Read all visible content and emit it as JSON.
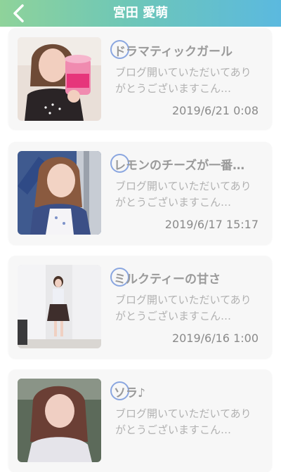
{
  "header": {
    "title": "宮田 愛萌"
  },
  "posts": [
    {
      "title": "ドラマティックガール",
      "excerpt": "ブログ開いていただいてありがとうございますこん…",
      "date": "2019/6/21 0:08"
    },
    {
      "title": "レモンのチーズが一番…",
      "excerpt": "ブログ開いていただいてありがとうございますこん…",
      "date": "2019/6/17 15:17"
    },
    {
      "title": "ミルクティーの甘さ",
      "excerpt": "ブログ開いていただいてありがとうございますこん…",
      "date": "2019/6/16 1:00"
    },
    {
      "title": "ソラ♪",
      "excerpt": "ブログ開いていただいてありがとうございますこん…",
      "date": ""
    }
  ],
  "colors": {
    "header_gradient": [
      "#8fd39a",
      "#5bb9df"
    ],
    "card_bg": "#f7f7f7",
    "dot_ring": "#8aa6e0"
  },
  "icons": {
    "back": "chevron-left-icon",
    "unread": "unread-dot-icon"
  }
}
